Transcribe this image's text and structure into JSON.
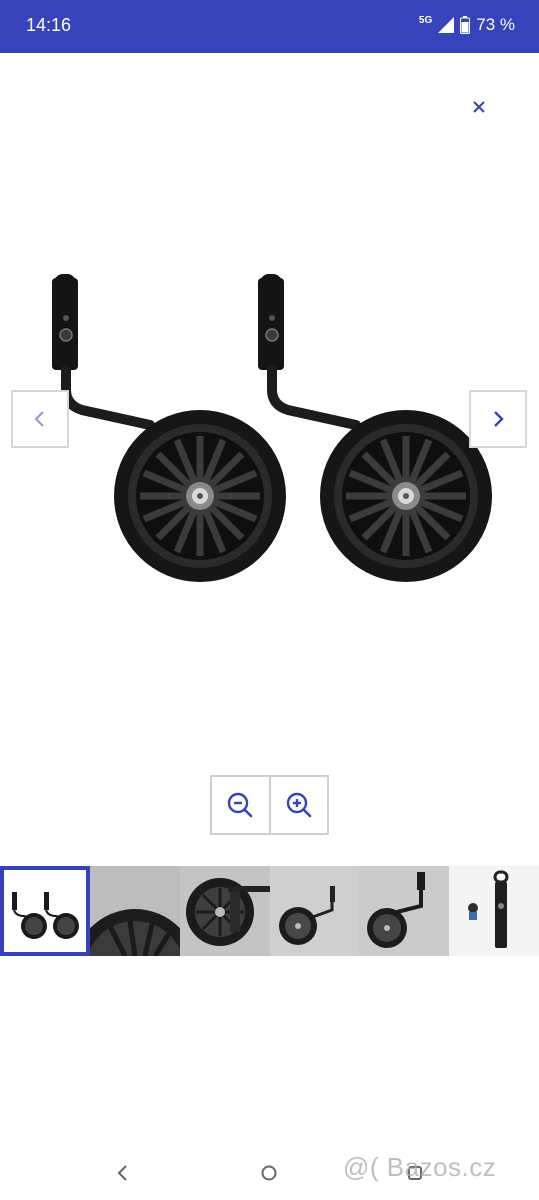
{
  "status_bar": {
    "time": "14:16",
    "network": "5G",
    "battery": "73 %",
    "background_color": "#3643ba"
  },
  "viewer": {
    "close_icon": "close-icon",
    "main_image_alt": "training-wheels-pair",
    "prev_icon": "chevron-left-icon",
    "next_icon": "chevron-right-icon",
    "zoom_out_icon": "zoom-out-icon",
    "zoom_in_icon": "zoom-in-icon",
    "accent_color": "#3643ba",
    "thumbnails": [
      {
        "name": "thumb-1",
        "selected": true
      },
      {
        "name": "thumb-2",
        "selected": false
      },
      {
        "name": "thumb-3",
        "selected": false
      },
      {
        "name": "thumb-4",
        "selected": false
      },
      {
        "name": "thumb-5",
        "selected": false
      },
      {
        "name": "thumb-6",
        "selected": false
      }
    ]
  },
  "nav_bar": {
    "back_icon": "back-icon",
    "home_icon": "home-icon",
    "recents_icon": "recents-icon"
  },
  "watermark": "@( Bazos.cz"
}
